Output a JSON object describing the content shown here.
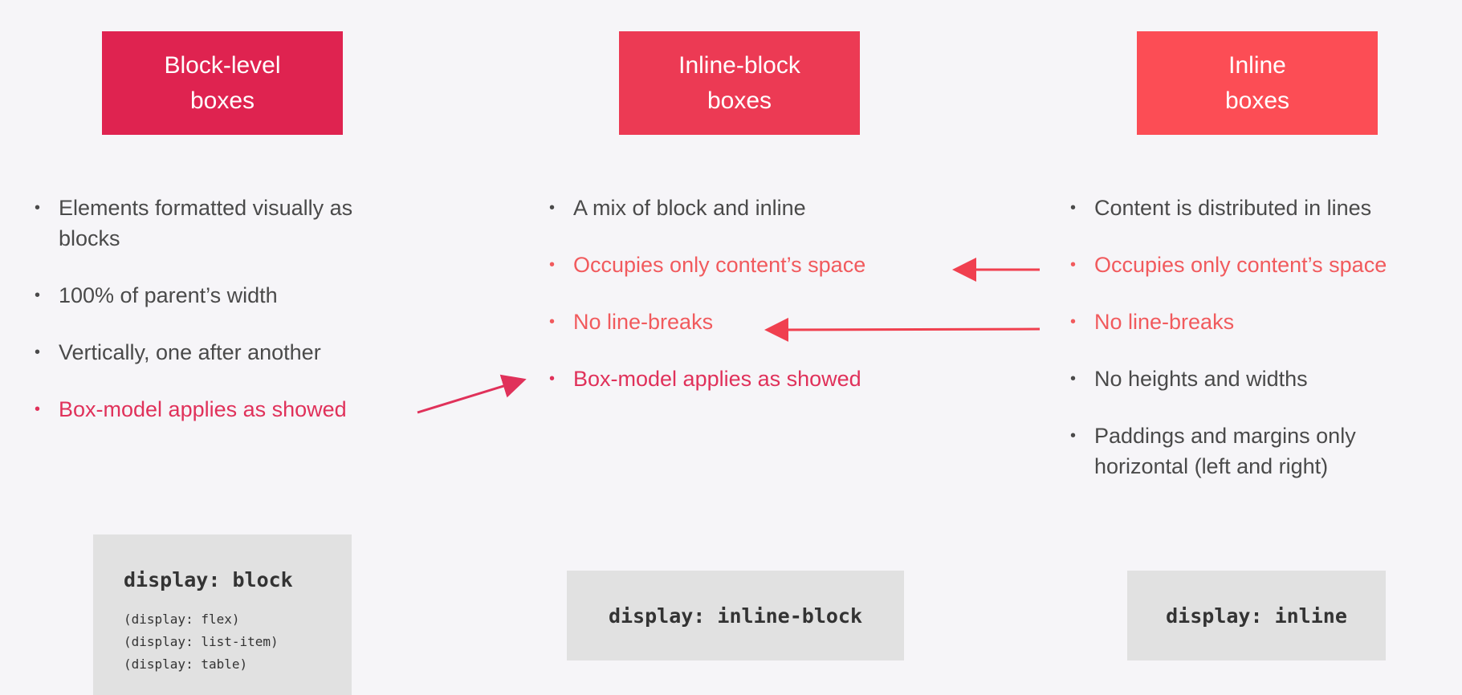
{
  "columns": [
    {
      "header": [
        "Block-level",
        "boxes"
      ],
      "items": [
        {
          "text": "Elements formatted visually as blocks",
          "highlight": false
        },
        {
          "text": "100% of parent’s width",
          "highlight": false
        },
        {
          "text": "Vertically, one after another",
          "highlight": false
        },
        {
          "text": "Box-model applies as showed",
          "highlight": true
        }
      ],
      "code": {
        "main": "display: block",
        "subs": [
          "(display: flex)",
          "(display: list-item)",
          "(display: table)"
        ]
      }
    },
    {
      "header": [
        "Inline-block",
        "boxes"
      ],
      "items": [
        {
          "text": "A mix of block and inline",
          "highlight": false
        },
        {
          "text": "Occupies only content’s space",
          "highlight": true
        },
        {
          "text": "No line-breaks",
          "highlight": true
        },
        {
          "text": "Box-model applies as showed",
          "highlight": true
        }
      ],
      "code": {
        "main": "display: inline-block"
      }
    },
    {
      "header": [
        "Inline",
        "boxes"
      ],
      "items": [
        {
          "text": "Content is distributed in lines",
          "highlight": false
        },
        {
          "text": "Occupies only content’s space",
          "highlight": true
        },
        {
          "text": "No line-breaks",
          "highlight": true
        },
        {
          "text": "No heights and widths",
          "highlight": false
        },
        {
          "text": "Paddings and margins only horizontal (left and right)",
          "highlight": false
        }
      ],
      "code": {
        "main": "display: inline"
      }
    }
  ],
  "colors": {
    "block_header": "#df2350",
    "inline_block_header": "#ec3a54",
    "inline_header": "#fc4d55",
    "highlight_pink": "#e0315a",
    "highlight_red": "#f15a5d",
    "background": "#f6f5f8",
    "code_bg": "#e1e1e1"
  }
}
